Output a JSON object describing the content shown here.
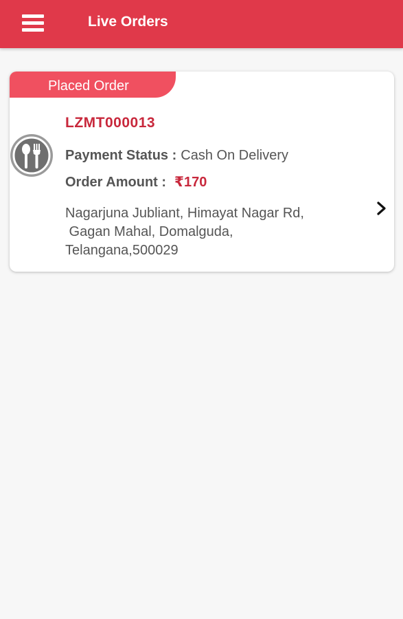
{
  "header": {
    "title": "Live Orders",
    "menu_icon": "hamburger-menu-icon",
    "background_color": "#e0394a"
  },
  "order": {
    "status": "Placed Order",
    "order_id": "LZMT000013",
    "payment_status_label": "Payment Status :",
    "payment_status_value": "Cash On Delivery",
    "order_amount_label": "Order Amount :",
    "order_amount_value": "₹170",
    "address_lines": [
      "Nagarjuna Jubliant, Himayat Nagar Rd,",
      " Gagan Mahal, Domalguda,",
      "Telangana,500029"
    ],
    "restaurant_icon": "spoon-fork-icon",
    "open_icon": "chevron-right-icon",
    "accent_color": "#c8283c"
  }
}
